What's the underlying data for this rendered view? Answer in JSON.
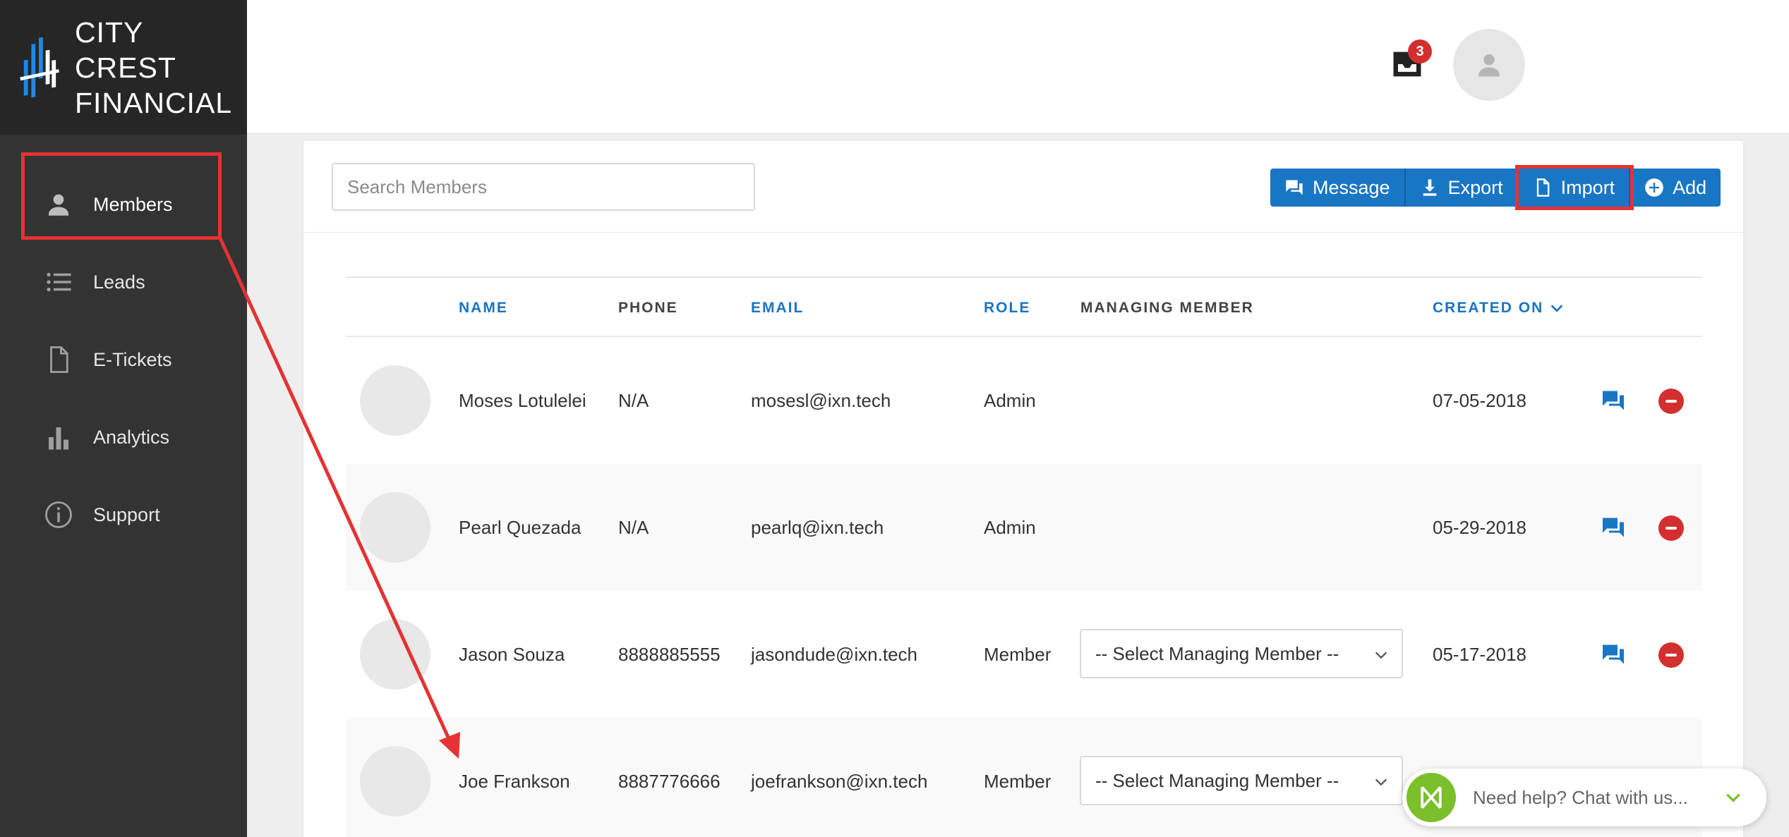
{
  "brand": {
    "line1": "CITY CREST",
    "line2": "FINANCIAL"
  },
  "sidebar": {
    "items": [
      {
        "label": "Members",
        "icon": "person-icon",
        "active": true
      },
      {
        "label": "Leads",
        "icon": "list-icon",
        "active": false
      },
      {
        "label": "E-Tickets",
        "icon": "document-icon",
        "active": false
      },
      {
        "label": "Analytics",
        "icon": "bar-chart-icon",
        "active": false
      },
      {
        "label": "Support",
        "icon": "info-icon",
        "active": false
      }
    ]
  },
  "header": {
    "notification_count": "3"
  },
  "search": {
    "placeholder": "Search Members"
  },
  "toolbar": {
    "message_label": "Message",
    "export_label": "Export",
    "import_label": "Import",
    "add_label": "Add"
  },
  "table": {
    "columns": {
      "name": "NAME",
      "phone": "PHONE",
      "email": "EMAIL",
      "role": "ROLE",
      "managing": "MANAGING MEMBER",
      "created": "CREATED ON"
    },
    "rows": [
      {
        "name": "Moses Lotulelei",
        "phone": "N/A",
        "email": "mosesl@ixn.tech",
        "role": "Admin",
        "managing": "",
        "created": "07-05-2018"
      },
      {
        "name": "Pearl Quezada",
        "phone": "N/A",
        "email": "pearlq@ixn.tech",
        "role": "Admin",
        "managing": "",
        "created": "05-29-2018"
      },
      {
        "name": "Jason Souza",
        "phone": "8888885555",
        "email": "jasondude@ixn.tech",
        "role": "Member",
        "managing": "-- Select Managing Member --",
        "created": "05-17-2018"
      },
      {
        "name": "Joe Frankson",
        "phone": "8887776666",
        "email": "joefrankson@ixn.tech",
        "role": "Member",
        "managing": "-- Select Managing Member --",
        "created": ""
      }
    ]
  },
  "chat": {
    "label": "Need help? Chat with us..."
  },
  "colors": {
    "accent": "#1976c5",
    "sidebar": "#333333",
    "annotation": "#e53232",
    "danger": "#d32f2f",
    "chat": "#7bbf2b"
  }
}
